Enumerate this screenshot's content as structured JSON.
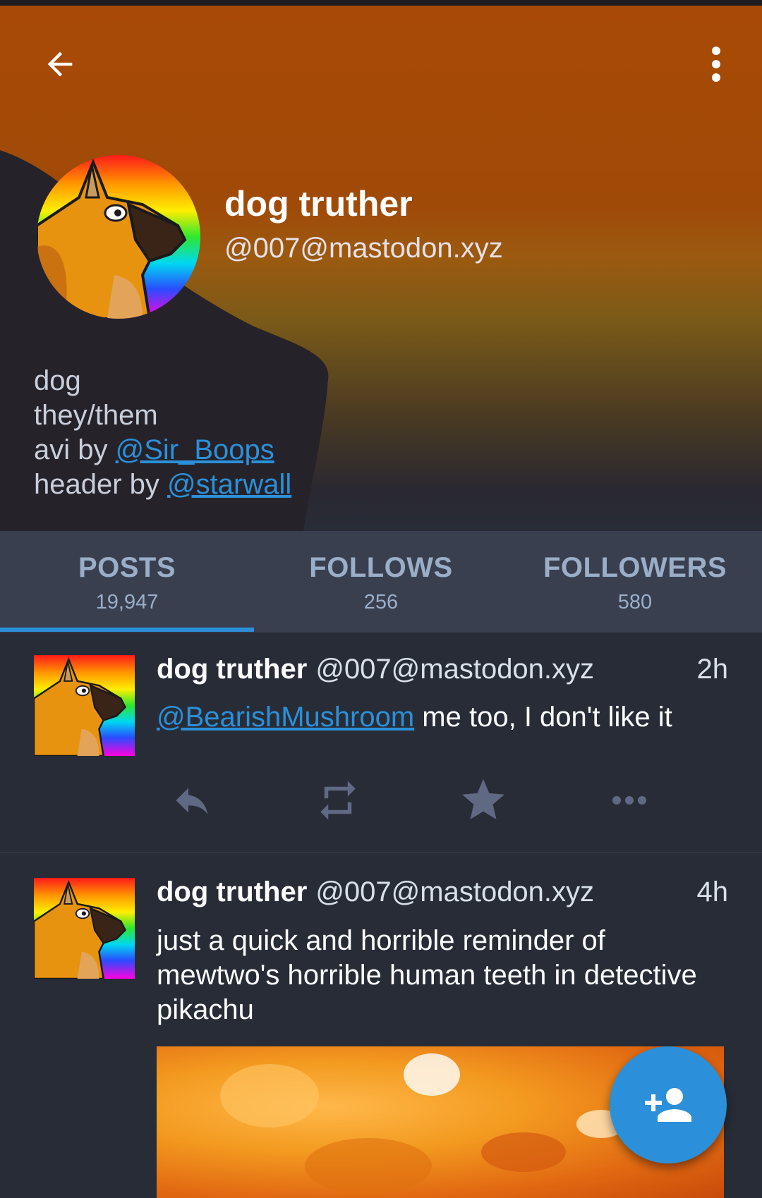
{
  "colors": {
    "accent": "#2b90d9",
    "background": "#282c37",
    "tab_bar": "#393f4f",
    "muted": "#9baec8"
  },
  "toolbar": {
    "back_icon": "arrow-left-icon",
    "menu_icon": "more-vert-icon"
  },
  "profile": {
    "display_name": "dog truther",
    "handle": "@007@mastodon.xyz",
    "bio": {
      "line1": "dog",
      "line2": "they/them",
      "avi_prefix": "avi by ",
      "avi_link": "@Sir_Boops",
      "header_prefix": "header by ",
      "header_link": "@starwall"
    }
  },
  "tabs": [
    {
      "label": "POSTS",
      "count": "19,947",
      "active": true
    },
    {
      "label": "FOLLOWS",
      "count": "256",
      "active": false
    },
    {
      "label": "FOLLOWERS",
      "count": "580",
      "active": false
    }
  ],
  "statuses": [
    {
      "name": "dog truther",
      "acct": "@007@mastodon.xyz",
      "time": "2h",
      "mention": "@BearishMushroom",
      "text": " me too, I don't like it",
      "actions": [
        "reply-icon",
        "boost-icon",
        "favourite-icon",
        "more-horiz-icon"
      ]
    },
    {
      "name": "dog truther",
      "acct": "@007@mastodon.xyz",
      "time": "4h",
      "text": "just a quick and horrible reminder of mewtwo's horrible human teeth in detective pikachu"
    }
  ],
  "fab": {
    "icon": "person-add-icon"
  }
}
